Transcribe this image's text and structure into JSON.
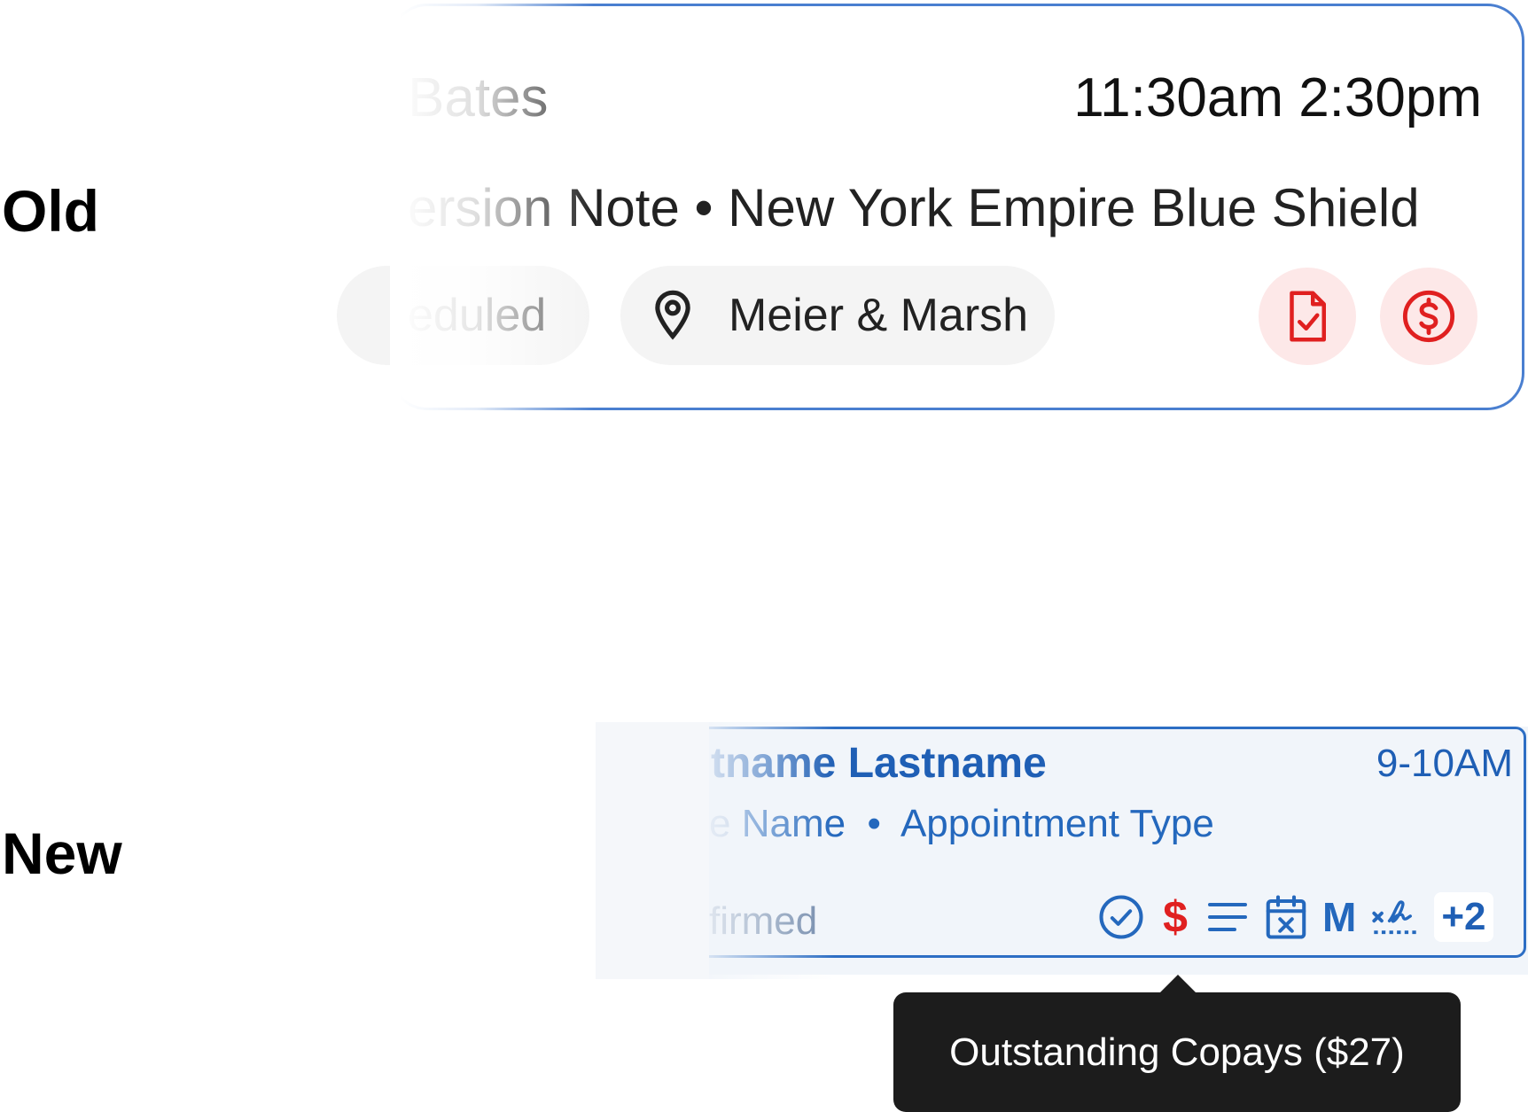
{
  "labels": {
    "old": "Old",
    "new": "New"
  },
  "old_card": {
    "name": "Bates",
    "times": "11:30am 2:30pm",
    "line2": "ersion Note • New York Empire Blue Shield",
    "status": "eduled",
    "location": "Meier & Marsh",
    "icons": [
      "location-pin-icon",
      "document-check-icon",
      "dollar-circle-icon"
    ]
  },
  "new_card": {
    "name": "tname Lastname",
    "time": "9-10AM",
    "line2": "Name  •  Appointment Type",
    "line2_prefix": "e",
    "status": "firmed",
    "icons": [
      "check-circle-icon",
      "dollar-icon",
      "notes-icon",
      "calendar-x-icon",
      "m-icon",
      "signature-icon"
    ],
    "dollar": "$",
    "m": "M",
    "more": "+2"
  },
  "tooltip": {
    "text": "Outstanding Copays ($27)"
  },
  "colors": {
    "old_border": "#4a7fd0",
    "new_border": "#2d6ec4",
    "new_text": "#1f5fb5",
    "red": "#e02020",
    "red_bg": "#fde8e8",
    "tooltip_bg": "#1c1c1c"
  }
}
